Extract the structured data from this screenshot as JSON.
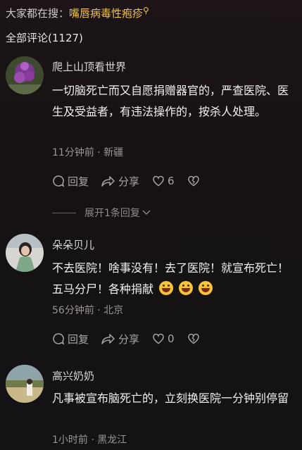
{
  "search": {
    "prefix": "大家都在搜：",
    "keyword": "嘴唇病毒性疱疹"
  },
  "comments_header": {
    "count_label": "全部评论(1127)"
  },
  "comments": [
    {
      "username": "爬上山顶看世界",
      "text": "一切脑死亡而又自愿捐赠器官的，严查医院、医生及受益者，有违法操作的，按杀人处理。",
      "meta": "11分钟前 · 新疆",
      "reply_label": "回复",
      "share_label": "分享",
      "likes": "6"
    },
    {
      "username": "朵朵贝儿",
      "text": "不去医院！啥事没有！去了医院！就宣布死亡！五马分尸！各种捐献",
      "meta": "56分钟前 · 北京",
      "reply_label": "回复",
      "share_label": "分享",
      "likes": "0"
    },
    {
      "username": "高兴奶奶",
      "text": "凡事被宣布脑死亡的，立刻换医院一分钟别停留",
      "meta": "1小时前 · 黑龙江"
    }
  ],
  "expand_replies": {
    "label": "展开1条回复"
  },
  "colors": {
    "keyword": "#f0c24a",
    "background": "#161214"
  }
}
